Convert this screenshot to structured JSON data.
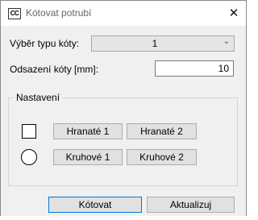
{
  "window": {
    "app_icon_text": "CC",
    "title": "Kótovat potrubí",
    "close_glyph": "✕"
  },
  "form": {
    "type_label": "Výběr typu kóty:",
    "type_value": "1",
    "offset_label": "Odsazení kóty [mm]:",
    "offset_value": "10"
  },
  "settings": {
    "group_title": "Nastavení",
    "square_icon": "square-shape-icon",
    "circle_icon": "circle-shape-icon",
    "buttons": {
      "square_1": "Hranaté 1",
      "square_2": "Hranaté 2",
      "round_1": "Kruhové 1",
      "round_2": "Kruhové 2"
    }
  },
  "footer": {
    "dimension_button": "Kótovat",
    "update_button": "Aktualizuj"
  },
  "colors": {
    "dialog_bg": "#f0f0f0",
    "button_bg": "#e1e1e1",
    "focus_border": "#0078d7"
  }
}
